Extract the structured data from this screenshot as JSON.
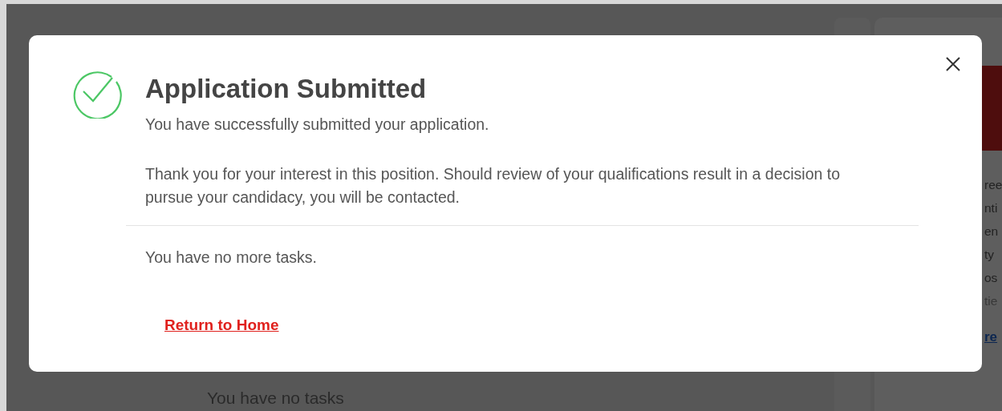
{
  "background_page": {
    "side_text": [
      "ree",
      "nti",
      "en",
      "ty",
      "os",
      "tie"
    ],
    "side_link": "re",
    "tasks_heading": "You have no tasks"
  },
  "dialog": {
    "title": "Application Submitted",
    "subtitle": "You have successfully submitted your application.",
    "message": "Thank you for your interest in this position. Should review of your qualifications result in a decision to pursue your candidacy, you will be contacted.",
    "tasks_note": "You have no more tasks.",
    "link": "Return to Home"
  }
}
